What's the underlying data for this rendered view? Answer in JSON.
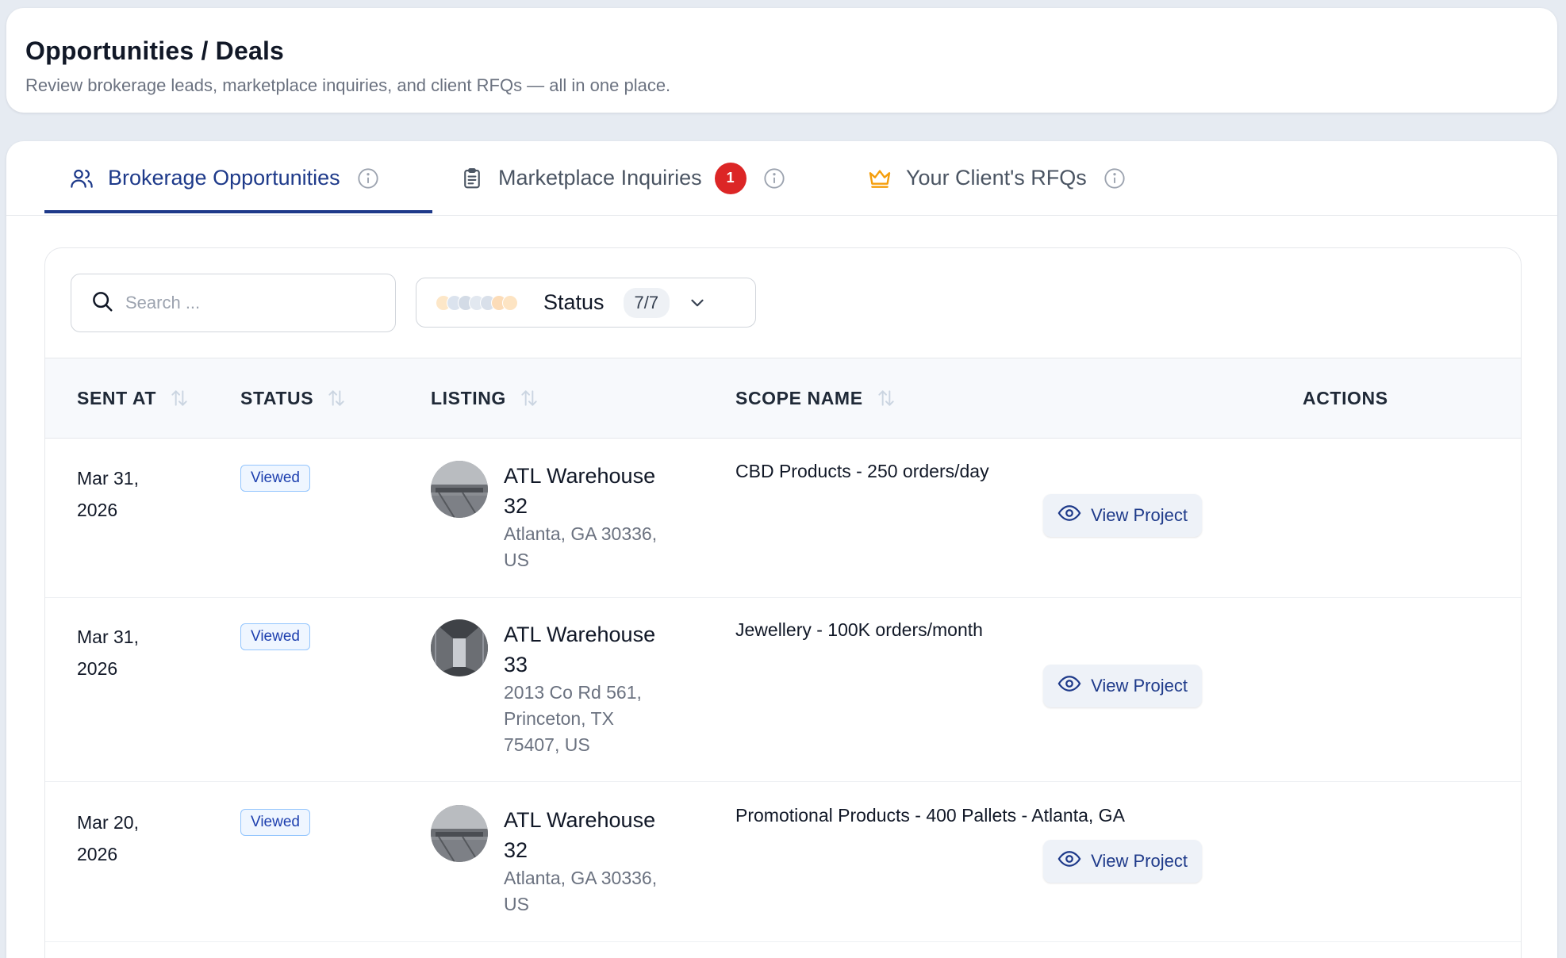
{
  "header": {
    "title": "Opportunities / Deals",
    "subtitle": "Review brokerage leads, marketplace inquiries, and client RFQs — all in one place."
  },
  "tabs": [
    {
      "label": "Brokerage Opportunities",
      "icon": "users-icon",
      "active": true
    },
    {
      "label": "Marketplace Inquiries",
      "icon": "clipboard-icon",
      "badge": "1"
    },
    {
      "label": "Your Client's RFQs",
      "icon": "crown-icon"
    }
  ],
  "filters": {
    "search_placeholder": "Search ...",
    "status_label": "Status",
    "status_count": "7/7"
  },
  "table": {
    "columns": [
      "SENT AT",
      "STATUS",
      "LISTING",
      "SCOPE NAME",
      "ACTIONS"
    ],
    "rows": [
      {
        "date_line1": "Mar 31,",
        "date_line2": "2026",
        "status": "Viewed",
        "listing_line1": "ATL Warehouse",
        "listing_line2": "32",
        "address": [
          "Atlanta, GA 30336,",
          "US"
        ],
        "scope": "CBD Products - 250 orders/day",
        "action": "View Project"
      },
      {
        "date_line1": "Mar 31,",
        "date_line2": "2026",
        "status": "Viewed",
        "listing_line1": "ATL Warehouse",
        "listing_line2": "33",
        "address": [
          "2013 Co Rd 561,",
          "Princeton, TX",
          "75407, US"
        ],
        "scope": "Jewellery - 100K orders/month",
        "action": "View Project"
      },
      {
        "date_line1": "Mar 20,",
        "date_line2": "2026",
        "status": "Viewed",
        "listing_line1": "ATL Warehouse",
        "listing_line2": "32",
        "address": [
          "Atlanta, GA 30336,",
          "US"
        ],
        "scope": "Promotional Products - 400 Pallets - Atlanta, GA",
        "action": "View Project"
      }
    ]
  },
  "colors": {
    "accent": "#1e3a8a",
    "badge_red": "#dc2626",
    "crown": "#f59e0b"
  }
}
